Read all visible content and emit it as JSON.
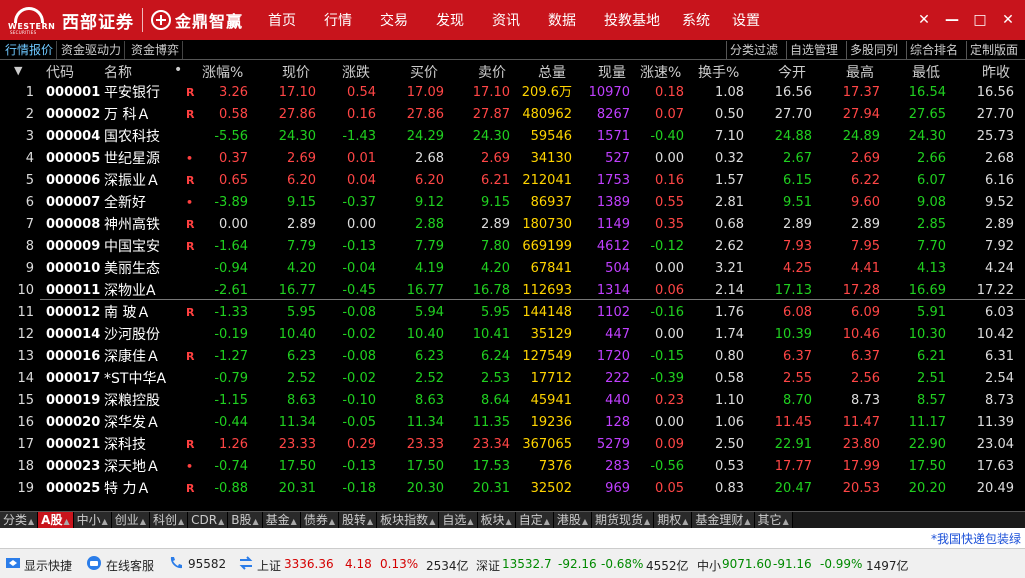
{
  "titlebar": {
    "brand_logo_text": "WESTERN",
    "brand_logo_sub": "SECURITIES",
    "brand_name": "西部证券",
    "app_name": "金鼎智赢",
    "menu": [
      "首页",
      "行情",
      "交易",
      "发现",
      "资讯",
      "数据",
      "投教基地",
      "系统",
      "设置"
    ],
    "window_buttons": [
      "✕",
      "—",
      "□",
      "✕"
    ],
    "colors": {
      "bar": "#c8141c"
    }
  },
  "subtabs_left": [
    "行情报价",
    "资金驱动力",
    "资金博弈"
  ],
  "subtabs_right": [
    "分类过滤",
    "自选管理",
    "多股同列",
    "综合排名",
    "定制版面"
  ],
  "table": {
    "headers": {
      "sort": "▼",
      "code": "代码",
      "name": "名称",
      "dot": "•",
      "pct": "涨幅%",
      "now": "现价",
      "chg": "涨跌",
      "buy": "买价",
      "sell": "卖价",
      "vol": "总量",
      "cur": "现量",
      "spd": "涨速%",
      "turn": "换手%",
      "open": "今开",
      "high": "最高",
      "low": "最低",
      "prev": "昨收"
    },
    "rows": [
      {
        "idx": "1",
        "code": "000001",
        "name": "平安银行",
        "flag": "R",
        "pct": "3.26",
        "now": "17.10",
        "chg": "0.54",
        "buy": "17.09",
        "sell": "17.10",
        "vol": "209.6万",
        "cur": "10970",
        "spd": "0.18",
        "turn": "1.08",
        "open": "16.56",
        "high": "17.37",
        "low": "16.54",
        "prev": "16.56",
        "cPct": "up",
        "cNow": "up",
        "cChg": "up",
        "cBuy": "up",
        "cSell": "up",
        "cSpd": "up",
        "cOpen": "eq",
        "cHigh": "up",
        "cLow": "dn"
      },
      {
        "idx": "2",
        "code": "000002",
        "name": "万 科Ａ",
        "flag": "R",
        "pct": "0.58",
        "now": "27.86",
        "chg": "0.16",
        "buy": "27.86",
        "sell": "27.87",
        "vol": "480962",
        "cur": "8267",
        "spd": "0.07",
        "turn": "0.50",
        "open": "27.70",
        "high": "27.94",
        "low": "27.65",
        "prev": "27.70",
        "cPct": "up",
        "cNow": "up",
        "cChg": "up",
        "cBuy": "up",
        "cSell": "up",
        "cSpd": "up",
        "cOpen": "eq",
        "cHigh": "up",
        "cLow": "dn"
      },
      {
        "idx": "3",
        "code": "000004",
        "name": "国农科技",
        "flag": "",
        "pct": "-5.56",
        "now": "24.30",
        "chg": "-1.43",
        "buy": "24.29",
        "sell": "24.30",
        "vol": "59546",
        "cur": "1571",
        "spd": "-0.40",
        "turn": "7.10",
        "open": "24.88",
        "high": "24.89",
        "low": "24.30",
        "prev": "25.73",
        "cPct": "dn",
        "cNow": "dn",
        "cChg": "dn",
        "cBuy": "dn",
        "cSell": "dn",
        "cSpd": "dn",
        "cOpen": "dn",
        "cHigh": "dn",
        "cLow": "dn"
      },
      {
        "idx": "4",
        "code": "000005",
        "name": "世纪星源",
        "flag": "•",
        "pct": "0.37",
        "now": "2.69",
        "chg": "0.01",
        "buy": "2.68",
        "sell": "2.69",
        "vol": "34130",
        "cur": "527",
        "spd": "0.00",
        "turn": "0.32",
        "open": "2.67",
        "high": "2.69",
        "low": "2.66",
        "prev": "2.68",
        "cPct": "up",
        "cNow": "up",
        "cChg": "up",
        "cBuy": "eq",
        "cSell": "up",
        "cSpd": "eq",
        "cOpen": "dn",
        "cHigh": "up",
        "cLow": "dn"
      },
      {
        "idx": "5",
        "code": "000006",
        "name": "深振业Ａ",
        "flag": "R",
        "pct": "0.65",
        "now": "6.20",
        "chg": "0.04",
        "buy": "6.20",
        "sell": "6.21",
        "vol": "212041",
        "cur": "1753",
        "spd": "0.16",
        "turn": "1.57",
        "open": "6.15",
        "high": "6.22",
        "low": "6.07",
        "prev": "6.16",
        "cPct": "up",
        "cNow": "up",
        "cChg": "up",
        "cBuy": "up",
        "cSell": "up",
        "cSpd": "up",
        "cOpen": "dn",
        "cHigh": "up",
        "cLow": "dn"
      },
      {
        "idx": "6",
        "code": "000007",
        "name": "全新好",
        "flag": "•",
        "pct": "-3.89",
        "now": "9.15",
        "chg": "-0.37",
        "buy": "9.12",
        "sell": "9.15",
        "vol": "86937",
        "cur": "1389",
        "spd": "0.55",
        "turn": "2.81",
        "open": "9.51",
        "high": "9.60",
        "low": "9.08",
        "prev": "9.52",
        "cPct": "dn",
        "cNow": "dn",
        "cChg": "dn",
        "cBuy": "dn",
        "cSell": "dn",
        "cSpd": "up",
        "cOpen": "dn",
        "cHigh": "up",
        "cLow": "dn"
      },
      {
        "idx": "7",
        "code": "000008",
        "name": "神州高铁",
        "flag": "R",
        "pct": "0.00",
        "now": "2.89",
        "chg": "0.00",
        "buy": "2.88",
        "sell": "2.89",
        "vol": "180730",
        "cur": "1149",
        "spd": "0.35",
        "turn": "0.68",
        "open": "2.89",
        "high": "2.89",
        "low": "2.85",
        "prev": "2.89",
        "cPct": "eq",
        "cNow": "eq",
        "cChg": "eq",
        "cBuy": "dn",
        "cSell": "eq",
        "cSpd": "up",
        "cOpen": "eq",
        "cHigh": "eq",
        "cLow": "dn"
      },
      {
        "idx": "8",
        "code": "000009",
        "name": "中国宝安",
        "flag": "R",
        "pct": "-1.64",
        "now": "7.79",
        "chg": "-0.13",
        "buy": "7.79",
        "sell": "7.80",
        "vol": "669199",
        "cur": "4612",
        "spd": "-0.12",
        "turn": "2.62",
        "open": "7.93",
        "high": "7.95",
        "low": "7.70",
        "prev": "7.92",
        "cPct": "dn",
        "cNow": "dn",
        "cChg": "dn",
        "cBuy": "dn",
        "cSell": "dn",
        "cSpd": "dn",
        "cOpen": "up",
        "cHigh": "up",
        "cLow": "dn"
      },
      {
        "idx": "9",
        "code": "000010",
        "name": "美丽生态",
        "flag": "",
        "pct": "-0.94",
        "now": "4.20",
        "chg": "-0.04",
        "buy": "4.19",
        "sell": "4.20",
        "vol": "67841",
        "cur": "504",
        "spd": "0.00",
        "turn": "3.21",
        "open": "4.25",
        "high": "4.41",
        "low": "4.13",
        "prev": "4.24",
        "cPct": "dn",
        "cNow": "dn",
        "cChg": "dn",
        "cBuy": "dn",
        "cSell": "dn",
        "cSpd": "eq",
        "cOpen": "up",
        "cHigh": "up",
        "cLow": "dn"
      },
      {
        "idx": "10",
        "code": "000011",
        "name": "深物业A",
        "flag": "",
        "pct": "-2.61",
        "now": "16.77",
        "chg": "-0.45",
        "buy": "16.77",
        "sell": "16.78",
        "vol": "112693",
        "cur": "1314",
        "spd": "0.06",
        "turn": "2.14",
        "open": "17.13",
        "high": "17.28",
        "low": "16.69",
        "prev": "17.22",
        "cPct": "dn",
        "cNow": "dn",
        "cChg": "dn",
        "cBuy": "dn",
        "cSell": "dn",
        "cSpd": "up",
        "cOpen": "dn",
        "cHigh": "up",
        "cLow": "dn"
      },
      {
        "idx": "11",
        "code": "000012",
        "name": "南 玻Ａ",
        "flag": "R",
        "pct": "-1.33",
        "now": "5.95",
        "chg": "-0.08",
        "buy": "5.94",
        "sell": "5.95",
        "vol": "144148",
        "cur": "1102",
        "spd": "-0.16",
        "turn": "1.76",
        "open": "6.08",
        "high": "6.09",
        "low": "5.91",
        "prev": "6.03",
        "cPct": "dn",
        "cNow": "dn",
        "cChg": "dn",
        "cBuy": "dn",
        "cSell": "dn",
        "cSpd": "dn",
        "cOpen": "up",
        "cHigh": "up",
        "cLow": "dn"
      },
      {
        "idx": "12",
        "code": "000014",
        "name": "沙河股份",
        "flag": "",
        "pct": "-0.19",
        "now": "10.40",
        "chg": "-0.02",
        "buy": "10.40",
        "sell": "10.41",
        "vol": "35129",
        "cur": "447",
        "spd": "0.00",
        "turn": "1.74",
        "open": "10.39",
        "high": "10.46",
        "low": "10.30",
        "prev": "10.42",
        "cPct": "dn",
        "cNow": "dn",
        "cChg": "dn",
        "cBuy": "dn",
        "cSell": "dn",
        "cSpd": "eq",
        "cOpen": "dn",
        "cHigh": "up",
        "cLow": "dn"
      },
      {
        "idx": "13",
        "code": "000016",
        "name": "深康佳Ａ",
        "flag": "R",
        "pct": "-1.27",
        "now": "6.23",
        "chg": "-0.08",
        "buy": "6.23",
        "sell": "6.24",
        "vol": "127549",
        "cur": "1720",
        "spd": "-0.15",
        "turn": "0.80",
        "open": "6.37",
        "high": "6.37",
        "low": "6.21",
        "prev": "6.31",
        "cPct": "dn",
        "cNow": "dn",
        "cChg": "dn",
        "cBuy": "dn",
        "cSell": "dn",
        "cSpd": "dn",
        "cOpen": "up",
        "cHigh": "up",
        "cLow": "dn"
      },
      {
        "idx": "14",
        "code": "000017",
        "name": "*ST中华A",
        "flag": "",
        "pct": "-0.79",
        "now": "2.52",
        "chg": "-0.02",
        "buy": "2.52",
        "sell": "2.53",
        "vol": "17712",
        "cur": "222",
        "spd": "-0.39",
        "turn": "0.58",
        "open": "2.55",
        "high": "2.56",
        "low": "2.51",
        "prev": "2.54",
        "cPct": "dn",
        "cNow": "dn",
        "cChg": "dn",
        "cBuy": "dn",
        "cSell": "dn",
        "cSpd": "dn",
        "cOpen": "up",
        "cHigh": "up",
        "cLow": "dn"
      },
      {
        "idx": "15",
        "code": "000019",
        "name": "深粮控股",
        "flag": "",
        "pct": "-1.15",
        "now": "8.63",
        "chg": "-0.10",
        "buy": "8.63",
        "sell": "8.64",
        "vol": "45941",
        "cur": "440",
        "spd": "0.23",
        "turn": "1.10",
        "open": "8.70",
        "high": "8.73",
        "low": "8.57",
        "prev": "8.73",
        "cPct": "dn",
        "cNow": "dn",
        "cChg": "dn",
        "cBuy": "dn",
        "cSell": "dn",
        "cSpd": "up",
        "cOpen": "dn",
        "cHigh": "eq",
        "cLow": "dn"
      },
      {
        "idx": "16",
        "code": "000020",
        "name": "深华发Ａ",
        "flag": "",
        "pct": "-0.44",
        "now": "11.34",
        "chg": "-0.05",
        "buy": "11.34",
        "sell": "11.35",
        "vol": "19236",
        "cur": "128",
        "spd": "0.00",
        "turn": "1.06",
        "open": "11.45",
        "high": "11.47",
        "low": "11.17",
        "prev": "11.39",
        "cPct": "dn",
        "cNow": "dn",
        "cChg": "dn",
        "cBuy": "dn",
        "cSell": "dn",
        "cSpd": "eq",
        "cOpen": "up",
        "cHigh": "up",
        "cLow": "dn"
      },
      {
        "idx": "17",
        "code": "000021",
        "name": "深科技",
        "flag": "R",
        "pct": "1.26",
        "now": "23.33",
        "chg": "0.29",
        "buy": "23.33",
        "sell": "23.34",
        "vol": "367065",
        "cur": "5279",
        "spd": "0.09",
        "turn": "2.50",
        "open": "22.91",
        "high": "23.80",
        "low": "22.90",
        "prev": "23.04",
        "cPct": "up",
        "cNow": "up",
        "cChg": "up",
        "cBuy": "up",
        "cSell": "up",
        "cSpd": "up",
        "cOpen": "dn",
        "cHigh": "up",
        "cLow": "dn"
      },
      {
        "idx": "18",
        "code": "000023",
        "name": "深天地Ａ",
        "flag": "•",
        "pct": "-0.74",
        "now": "17.50",
        "chg": "-0.13",
        "buy": "17.50",
        "sell": "17.53",
        "vol": "7376",
        "cur": "283",
        "spd": "-0.56",
        "turn": "0.53",
        "open": "17.77",
        "high": "17.99",
        "low": "17.50",
        "prev": "17.63",
        "cPct": "dn",
        "cNow": "dn",
        "cChg": "dn",
        "cBuy": "dn",
        "cSell": "dn",
        "cSpd": "dn",
        "cOpen": "up",
        "cHigh": "up",
        "cLow": "dn"
      },
      {
        "idx": "19",
        "code": "000025",
        "name": "特 力Ａ",
        "flag": "R",
        "pct": "-0.88",
        "now": "20.31",
        "chg": "-0.18",
        "buy": "20.30",
        "sell": "20.31",
        "vol": "32502",
        "cur": "969",
        "spd": "0.05",
        "turn": "0.83",
        "open": "20.47",
        "high": "20.53",
        "low": "20.20",
        "prev": "20.49",
        "cPct": "dn",
        "cNow": "dn",
        "cChg": "dn",
        "cBuy": "dn",
        "cSell": "dn",
        "cSpd": "up",
        "cOpen": "dn",
        "cHigh": "up",
        "cLow": "dn"
      }
    ]
  },
  "bottom_tabs": [
    {
      "label": "分类",
      "active": false
    },
    {
      "label": "A股",
      "active": true
    },
    {
      "label": "中小",
      "active": false
    },
    {
      "label": "创业",
      "active": false
    },
    {
      "label": "科创",
      "active": false
    },
    {
      "label": "CDR",
      "active": false
    },
    {
      "label": "B股",
      "active": false
    },
    {
      "label": "基金",
      "active": false
    },
    {
      "label": "债券",
      "active": false
    },
    {
      "label": "股转",
      "active": false
    },
    {
      "label": "板块指数",
      "active": false
    },
    {
      "label": "自选",
      "active": false
    },
    {
      "label": "板块",
      "active": false
    },
    {
      "label": "自定",
      "active": false
    },
    {
      "label": "港股",
      "active": false
    },
    {
      "label": "期货现货",
      "active": false
    },
    {
      "label": "期权",
      "active": false
    },
    {
      "label": "基金理财",
      "active": false
    },
    {
      "label": "其它",
      "active": false
    }
  ],
  "notice": "*我国快递包装绿",
  "statusbar": {
    "show_shortcut": "显示快捷",
    "online_service": "在线客服",
    "hotline": "95582",
    "sh_label": "上证",
    "sh_value": "3336.36",
    "sh_chg": "4.18",
    "sh_pct": "0.13%",
    "sh_amt": "2534亿",
    "sz_label": "深证",
    "sz_value": "13532.7",
    "sz_chg": "-92.16",
    "sz_pct": "-0.68%",
    "sz_amt": "4552亿",
    "zx_label": "中小",
    "zx_value": "9071.60",
    "zx_chg": "-91.16",
    "zx_pct": "-0.99%",
    "zx_amt": "1497亿"
  }
}
